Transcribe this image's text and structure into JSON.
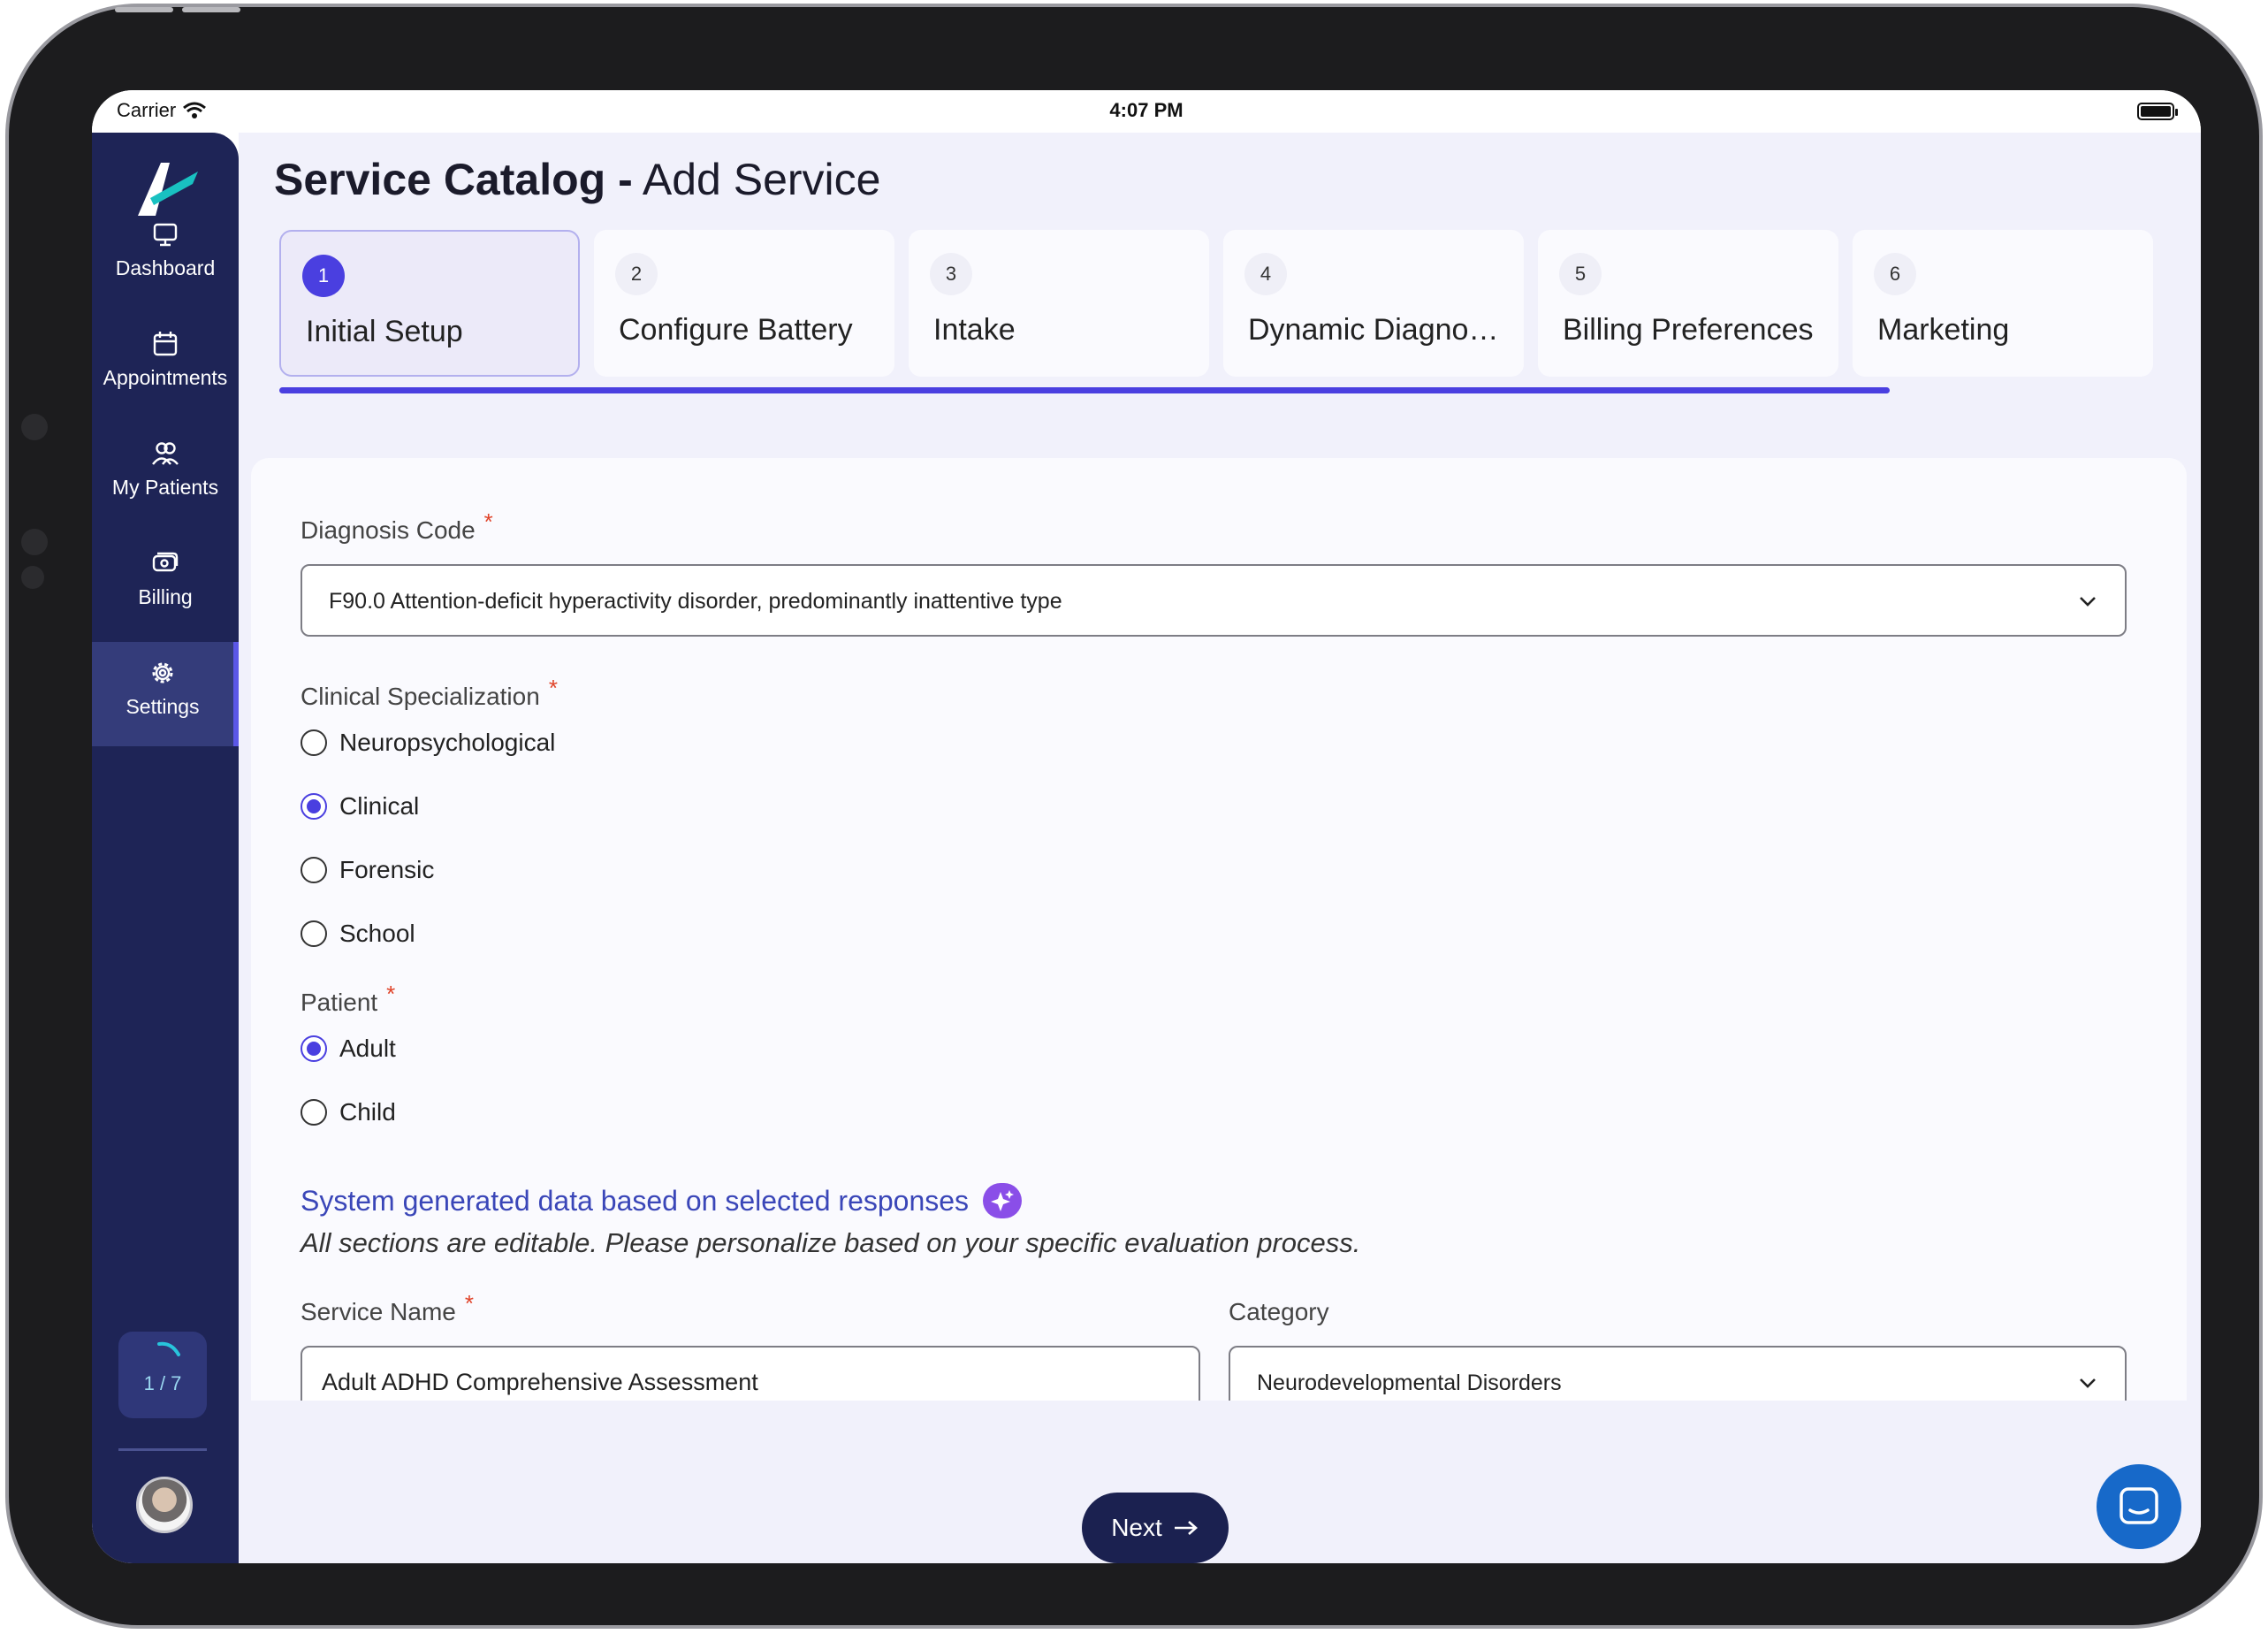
{
  "status_bar": {
    "carrier": "Carrier",
    "time": "4:07 PM"
  },
  "sidebar": {
    "items": [
      {
        "label": "Dashboard",
        "icon": "monitor-icon"
      },
      {
        "label": "Appointments",
        "icon": "calendar-icon"
      },
      {
        "label": "My Patients",
        "icon": "users-icon"
      },
      {
        "label": "Billing",
        "icon": "money-icon"
      },
      {
        "label": "Settings",
        "icon": "gear-icon",
        "active": true
      }
    ],
    "progress": "1 / 7"
  },
  "header": {
    "title_strong": "Service Catalog -",
    "title_light": "Add Service"
  },
  "steps": [
    {
      "num": "1",
      "label": "Initial Setup",
      "active": true
    },
    {
      "num": "2",
      "label": "Configure Battery"
    },
    {
      "num": "3",
      "label": "Intake"
    },
    {
      "num": "4",
      "label": "Dynamic Diagnosti..."
    },
    {
      "num": "5",
      "label": "Billing Preferences"
    },
    {
      "num": "6",
      "label": "Marketing"
    }
  ],
  "form": {
    "diagnosis": {
      "label": "Diagnosis Code",
      "required": "*",
      "value": "F90.0 Attention-deficit hyperactivity disorder, predominantly inattentive type"
    },
    "specialization": {
      "label": "Clinical Specialization",
      "required": "*",
      "options": [
        "Neuropsychological",
        "Clinical",
        "Forensic",
        "School"
      ],
      "selected": "Clinical"
    },
    "patient": {
      "label": "Patient",
      "required": "*",
      "options": [
        "Adult",
        "Child"
      ],
      "selected": "Adult"
    },
    "system_title": "System generated data based on selected responses",
    "system_subtitle": "All sections are editable. Please personalize based on your specific evaluation process.",
    "service_name": {
      "label": "Service Name",
      "required": "*",
      "value": "Adult ADHD Comprehensive Assessment"
    },
    "category": {
      "label": "Category",
      "value": "Neurodevelopmental Disorders"
    }
  },
  "actions": {
    "next_label": "Next"
  },
  "colors": {
    "sidebar": "#1e2456",
    "accent": "#4a3fe0",
    "required": "#e0442a",
    "link": "#3a46b8"
  }
}
